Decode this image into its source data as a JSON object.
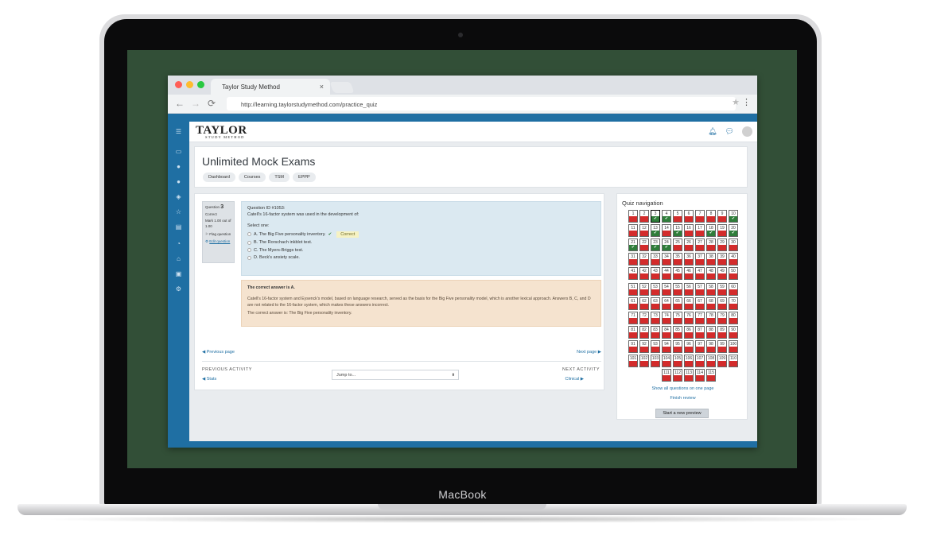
{
  "device": {
    "brand": "MacBook"
  },
  "browser": {
    "tab_title": "Taylor Study Method",
    "tab_close": "×",
    "url": "http://learning.taylorstudymethod.com/practice_quiz",
    "back": "←",
    "forward": "→",
    "reload": "⟳",
    "star": "★",
    "menu": "⋮"
  },
  "colors": {
    "brand": "#1f6fa3",
    "correct": "#2f7d3a",
    "incorrect": "#d32b2b",
    "desk": "#324f37"
  },
  "logo": {
    "name": "TAYLOR",
    "tagline": "STUDY METHOD"
  },
  "topnav": {
    "icons": [
      "bell-icon",
      "chat-icon",
      "avatar"
    ]
  },
  "header": {
    "title": "Unlimited Mock Exams",
    "breadcrumbs": [
      "Dashboard",
      "Courses",
      "TSM",
      "EPPP"
    ]
  },
  "question_info": {
    "label": "Question",
    "number": "3",
    "status": "Correct",
    "mark": "Mark 1.00 out of 1.00",
    "flag": "Flag question",
    "edit": "Edit question"
  },
  "question": {
    "id": "Question ID #1053:",
    "text": "Catell's 16-factor system was used in the development of:",
    "select_one": "Select one:",
    "options": [
      "A. The Big Five personality inventory.",
      "B. The Rorschach inkblot test.",
      "C. The Myers-Briggs test.",
      "D. Beck's anxiety scale."
    ],
    "correct_tag": "Correct",
    "check": "✔"
  },
  "feedback": {
    "heading": "The correct answer is A.",
    "explanation": "Catell's 16-factor system and Eysenck's model, based on language research, served as the basis for the Big Five personality model, which is another lexical approach. Answers B, C, and D are not related to the 16-factor system, which makes these answers incorrect.",
    "correct_answer": "The correct answer is: The Big Five personality inventory."
  },
  "pagination": {
    "previous": "◀ Previous page",
    "next": "Next page ▶"
  },
  "activity": {
    "previous_label": "PREVIOUS ACTIVITY",
    "previous_link": "◀ Stats",
    "jump_placeholder": "Jump to...",
    "next_label": "NEXT ACTIVITY",
    "next_link": "Clinical ▶"
  },
  "quiz_nav": {
    "title": "Quiz navigation",
    "total": 115,
    "current": 3,
    "correct_questions": [
      3,
      4,
      10,
      13,
      15,
      18,
      20,
      21,
      23,
      24
    ],
    "show_all": "Show all questions on one page",
    "finish": "Finish review",
    "new_preview": "Start a new preview"
  }
}
